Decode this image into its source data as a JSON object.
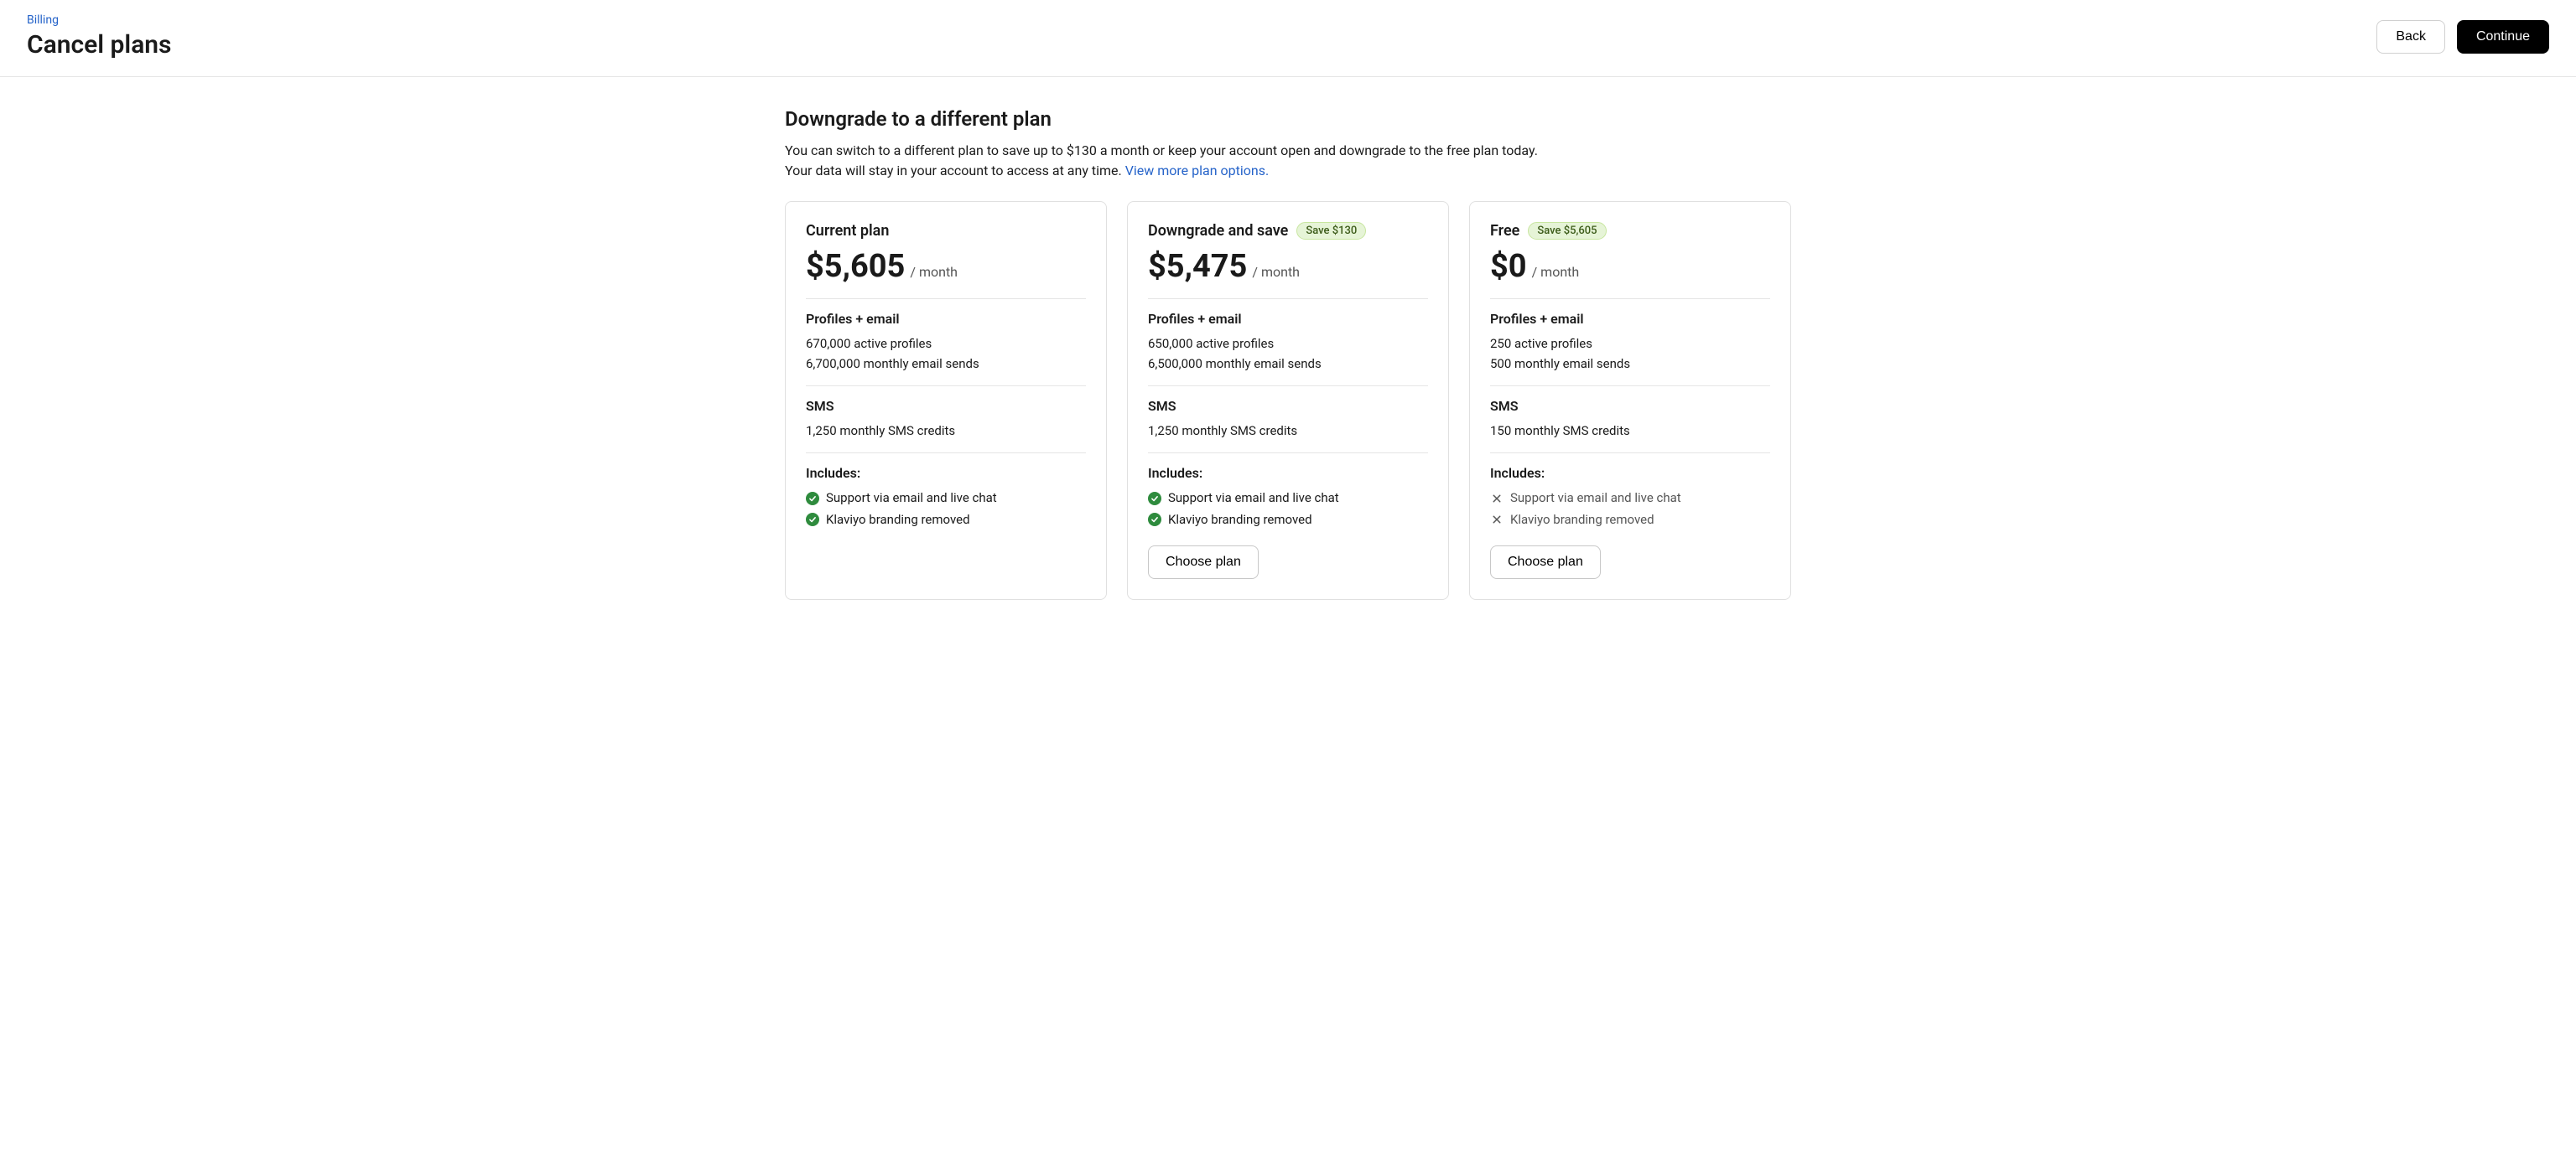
{
  "breadcrumb": "Billing",
  "page_title": "Cancel plans",
  "buttons": {
    "back": "Back",
    "continue": "Continue"
  },
  "section": {
    "title": "Downgrade to a different plan",
    "desc": "You can switch to a different plan to save up to $130 a month or keep your account open and downgrade to the free plan today. Your data will stay in your account to access at any time. ",
    "link": "View more plan options."
  },
  "labels": {
    "per_month": "/ month",
    "profiles_email": "Profiles + email",
    "sms": "SMS",
    "includes": "Includes:",
    "choose": "Choose plan"
  },
  "plans": [
    {
      "title": "Current plan",
      "badge": null,
      "price": "$5,605",
      "active_profiles": "670,000 active profiles",
      "email_sends": "6,700,000 monthly email sends",
      "sms_credits": "1,250 monthly SMS credits",
      "features": [
        {
          "text": "Support via email and live chat",
          "included": true
        },
        {
          "text": "Klaviyo branding removed",
          "included": true
        }
      ],
      "choose": false
    },
    {
      "title": "Downgrade and save",
      "badge": "Save $130",
      "price": "$5,475",
      "active_profiles": "650,000 active profiles",
      "email_sends": "6,500,000 monthly email sends",
      "sms_credits": "1,250 monthly SMS credits",
      "features": [
        {
          "text": "Support via email and live chat",
          "included": true
        },
        {
          "text": "Klaviyo branding removed",
          "included": true
        }
      ],
      "choose": true
    },
    {
      "title": "Free",
      "badge": "Save $5,605",
      "price": "$0",
      "active_profiles": "250 active profiles",
      "email_sends": "500 monthly email sends",
      "sms_credits": "150 monthly SMS credits",
      "features": [
        {
          "text": "Support via email and live chat",
          "included": false
        },
        {
          "text": "Klaviyo branding removed",
          "included": false
        }
      ],
      "choose": true
    }
  ]
}
